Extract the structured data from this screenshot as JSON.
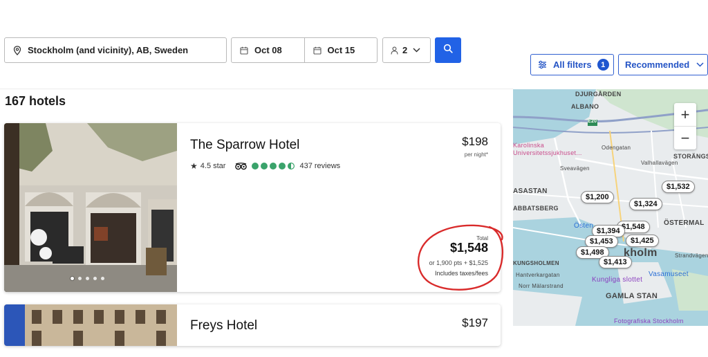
{
  "search": {
    "location": "Stockholm (and vicinity), AB, Sweden",
    "checkin": "Oct 08",
    "checkout": "Oct 15",
    "guests": "2"
  },
  "toolbar": {
    "filters_label": "All filters",
    "filters_count": "1",
    "sort_label": "Recommended"
  },
  "results": {
    "count_text": "167 hotels"
  },
  "hotels": [
    {
      "name": "The Sparrow Hotel",
      "star_text": "4.5 star",
      "reviews": "437 reviews",
      "tripadvisor_rating": 4.5,
      "nightly_price": "$198",
      "nightly_label": "per night*",
      "total_label": "Total",
      "total_price": "$1,548",
      "points": "or 1,900 pts + $1,525",
      "taxes_note": "Includes taxes/fees",
      "photo_count": 5,
      "active_photo": 1
    },
    {
      "name": "Freys Hotel",
      "nightly_price": "$197"
    }
  ],
  "map": {
    "zoom_in": "+",
    "zoom_out": "−",
    "labels": [
      "DJURGÅRDEN",
      "ALBANO",
      "E20",
      "Karolinska",
      "Universitetssjukhuset...",
      "STORÄNGSB",
      "ASASTAN",
      "ABBATSBERG",
      "ÖSTERMAL",
      "Östen",
      "kholm",
      "KUNGSHOLMEN",
      "Hantverkargatan",
      "Norr Mälarstrand",
      "Kungliga slottet",
      "Vasamuseet",
      "GAMLA STAN",
      "Fotografiska Stockholm",
      "Odengatan",
      "Valhallavägen",
      "Sveavägen",
      "Strandvägen"
    ],
    "price_markers": [
      "$1,200",
      "$1,532",
      "$1,324",
      "$1,548",
      "$1,394",
      "$1,453",
      "$1,425",
      "$1,498",
      "$1,413"
    ]
  },
  "colors": {
    "brand_blue": "#2162e6",
    "tripadvisor_green": "#3aa36b",
    "circle_red": "#d92b2b"
  }
}
